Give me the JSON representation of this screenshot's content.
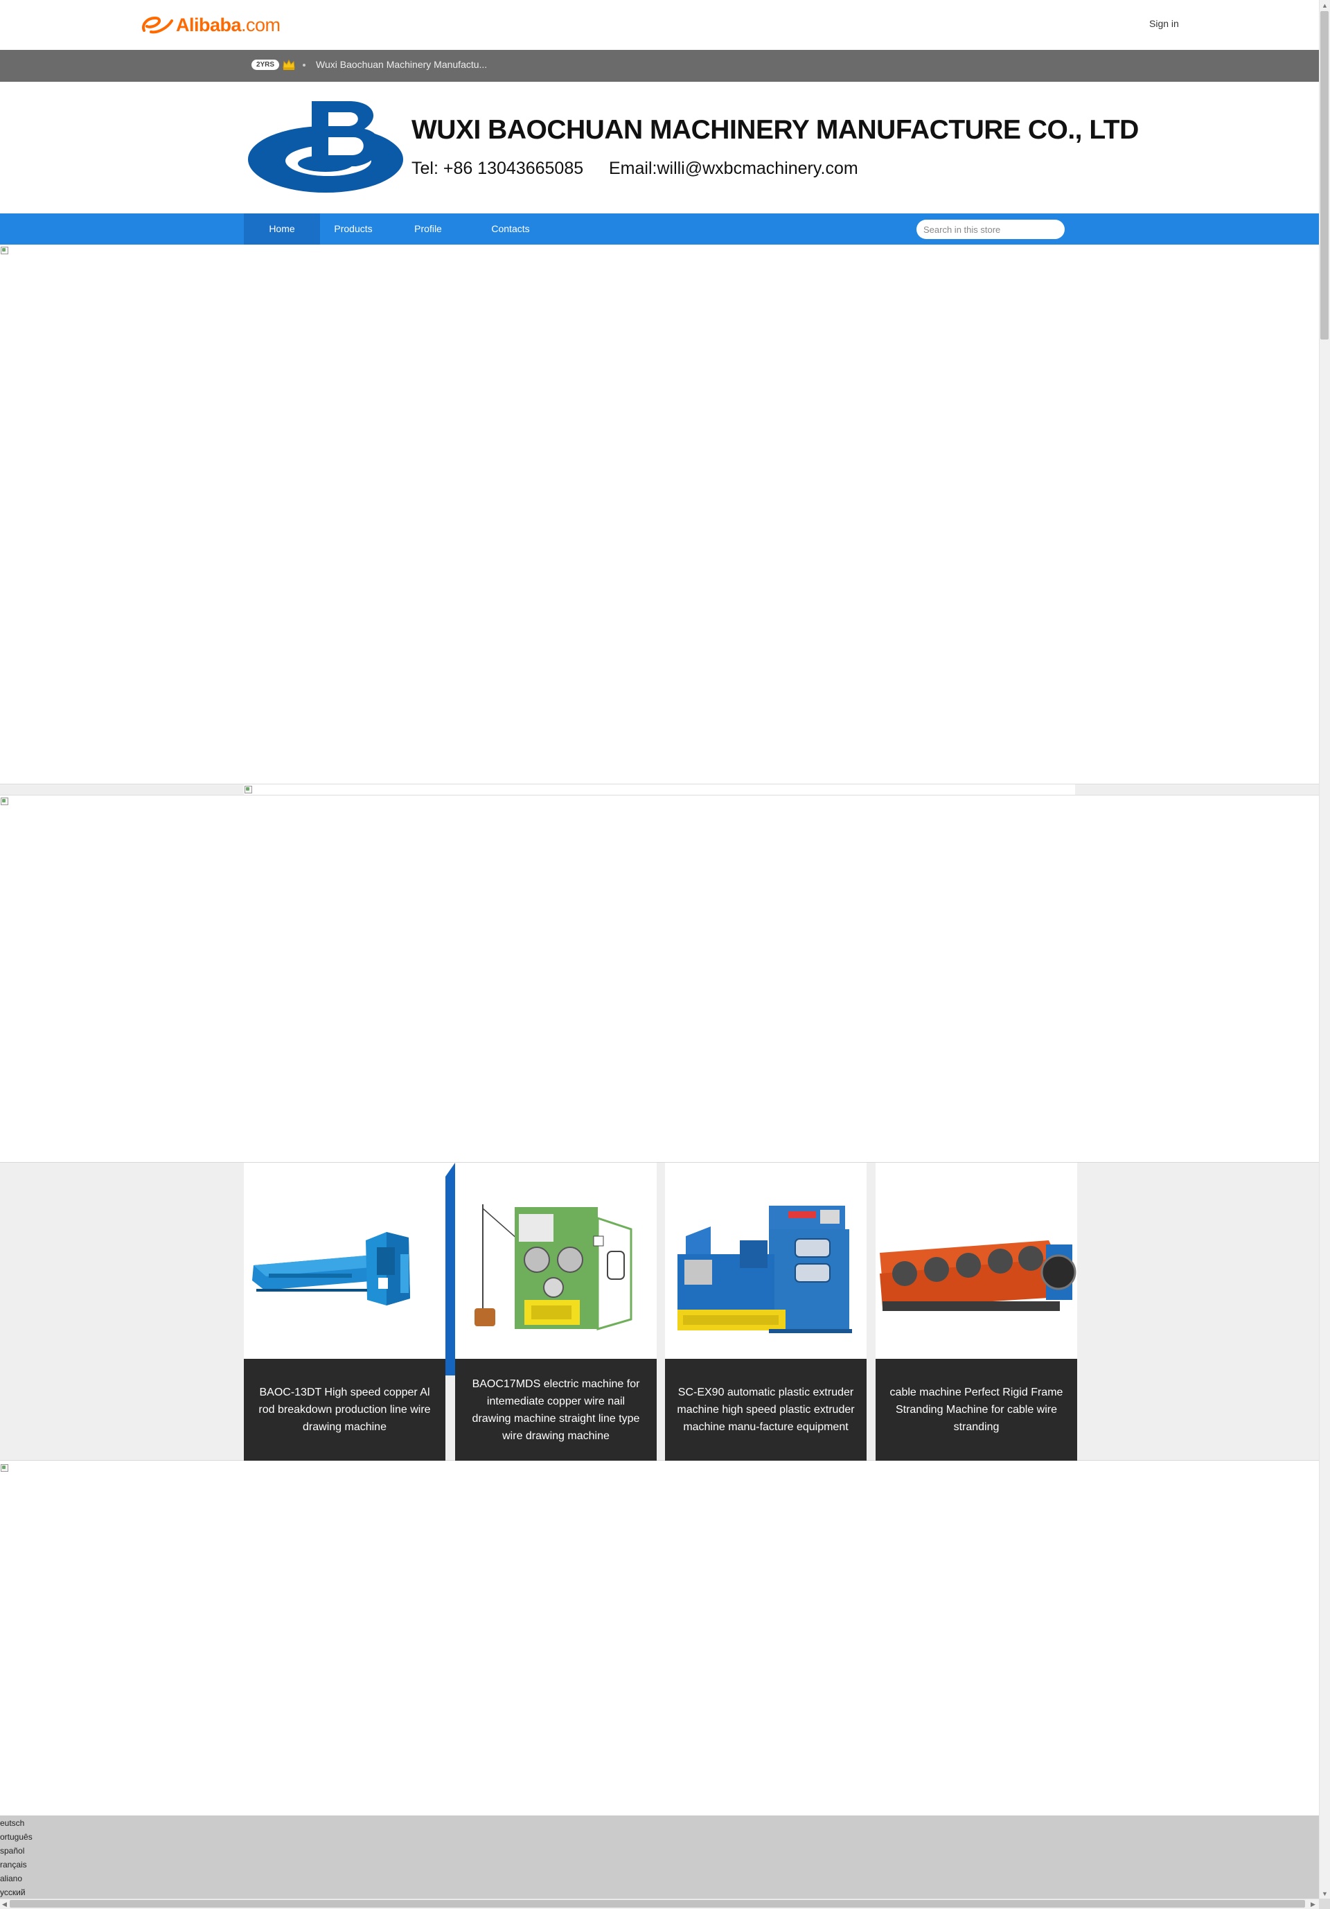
{
  "header": {
    "logo_text": "Alibaba",
    "logo_suffix": ".com",
    "signin_label": "Sign in"
  },
  "supplier_bar": {
    "years_badge": "2YRS",
    "supplier_name": "Wuxi Baochuan Machinery Manufactu..."
  },
  "brand_banner": {
    "company_name": "WUXI BAOCHUAN MACHINERY MANUFACTURE CO., LTD",
    "tel": "Tel: +86 13043665085",
    "email": "Email:willi@wxbcmachinery.com"
  },
  "nav": {
    "items": [
      {
        "label": "Home",
        "active": true
      },
      {
        "label": "Products",
        "active": false
      },
      {
        "label": "Profile",
        "active": false
      },
      {
        "label": "Contacts",
        "active": false
      }
    ],
    "search_placeholder": "Search in this store"
  },
  "products": [
    {
      "title": "BAOC-13DT High speed copper Al rod breakdown production line wire drawing machine",
      "image": "blue-wire-drawing-line"
    },
    {
      "title": "BAOC17MDS electric machine for intemediate copper wire nail drawing machine straight line type wire drawing machine",
      "image": "green-wire-drawing-machine"
    },
    {
      "title": "SC-EX90 automatic plastic extruder machine high speed plastic extruder machine manu-facture equipment",
      "image": "blue-extruder-machine"
    },
    {
      "title": "cable machine Perfect Rigid Frame Stranding Machine for cable wire stranding",
      "image": "orange-stranding-machine"
    }
  ],
  "language_list": [
    "eutsch",
    "ortuguês",
    "spañol",
    "rançais",
    "aliano",
    "усский"
  ],
  "colors": {
    "nav_blue": "#2185e1",
    "nav_active": "#1a6fc7",
    "brand_blue": "#0b5aa8",
    "alibaba_orange": "#ff6a00",
    "caption_bg": "#2a2a2a"
  }
}
